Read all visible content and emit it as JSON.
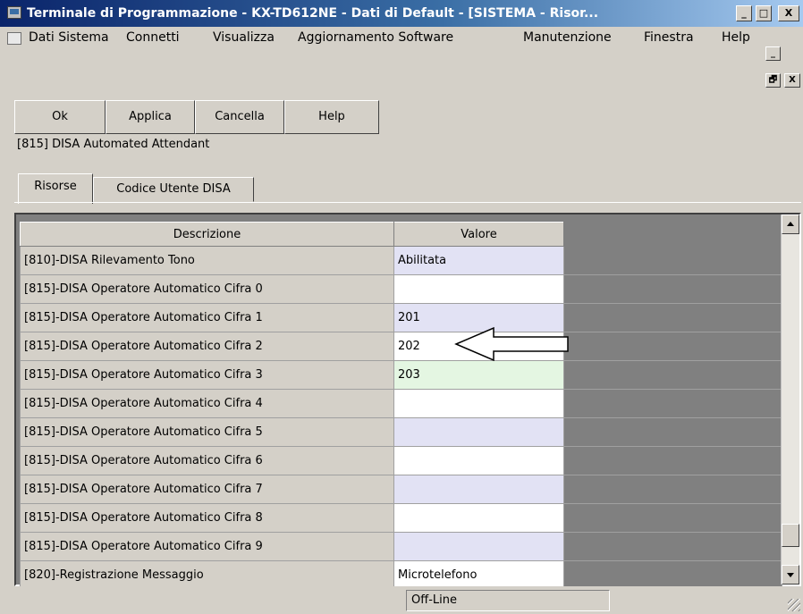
{
  "window": {
    "title": "Terminale di Programmazione - KX-TD612NE - Dati di Default - [SISTEMA - Risor...",
    "min_glyph": "_",
    "max_glyph": "□",
    "close_glyph": "X"
  },
  "menu": {
    "items": [
      "Dati Sistema",
      "Connetti",
      "Visualizza",
      "Aggiornamento Software",
      "Manutenzione",
      "Finestra",
      "Help"
    ],
    "mdi_min": "_",
    "mdi_restore": "🗗",
    "mdi_close": "X"
  },
  "toolbar": {
    "ok": "Ok",
    "apply": "Applica",
    "cancel": "Cancella",
    "help": "Help"
  },
  "section_title": "[815] DISA Automated Attendant",
  "tabs": [
    "Risorse",
    "Codice Utente DISA"
  ],
  "table": {
    "headers": [
      "Descrizione",
      "Valore"
    ],
    "rows": [
      {
        "desc": "[810]-DISA Rilevamento Tono",
        "value": "Abilitata",
        "tint": "lav"
      },
      {
        "desc": "[815]-DISA Operatore Automatico Cifra 0",
        "value": "",
        "tint": "white"
      },
      {
        "desc": "[815]-DISA Operatore Automatico Cifra 1",
        "value": "201",
        "tint": "lav"
      },
      {
        "desc": "[815]-DISA Operatore Automatico Cifra 2",
        "value": "202",
        "tint": "white"
      },
      {
        "desc": "[815]-DISA Operatore Automatico Cifra 3",
        "value": "203",
        "tint": "green"
      },
      {
        "desc": "[815]-DISA Operatore Automatico Cifra 4",
        "value": "",
        "tint": "white"
      },
      {
        "desc": "[815]-DISA Operatore Automatico Cifra 5",
        "value": "",
        "tint": "lav"
      },
      {
        "desc": "[815]-DISA Operatore Automatico Cifra 6",
        "value": "",
        "tint": "white"
      },
      {
        "desc": "[815]-DISA Operatore Automatico Cifra 7",
        "value": "",
        "tint": "lav"
      },
      {
        "desc": "[815]-DISA Operatore Automatico Cifra 8",
        "value": "",
        "tint": "white"
      },
      {
        "desc": "[815]-DISA Operatore Automatico Cifra 9",
        "value": "",
        "tint": "lav"
      },
      {
        "desc": "[820]-Registrazione Messaggio",
        "value": "Microtelefono",
        "tint": "white"
      }
    ]
  },
  "status": {
    "mode": "Off-Line"
  },
  "colors": {
    "title_start": "#0a246a",
    "title_end": "#a6caf0",
    "row_lavender": "#e2e2f4",
    "row_green": "#e4f6e2"
  }
}
